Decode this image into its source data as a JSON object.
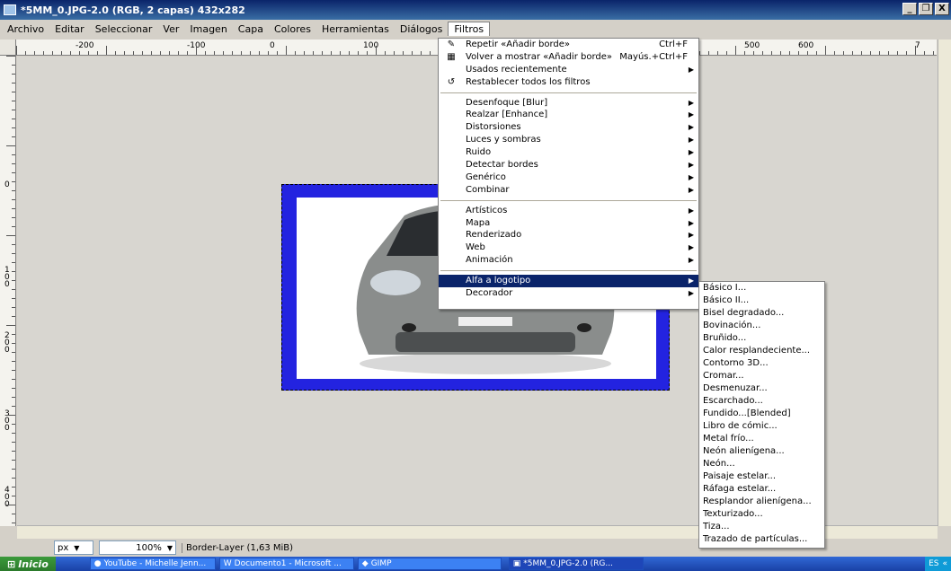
{
  "window": {
    "title": "*5MM_0.JPG-2.0 (RGB, 2 capas) 432x282",
    "buttons": [
      "_",
      "❐",
      "X"
    ]
  },
  "menubar": [
    "Archivo",
    "Editar",
    "Seleccionar",
    "Ver",
    "Imagen",
    "Capa",
    "Colores",
    "Herramientas",
    "Diálogos",
    "Filtros"
  ],
  "ruler_top": [
    "-200",
    "-100",
    "0",
    "100",
    "500",
    "600",
    "7"
  ],
  "ruler_left": [
    "0",
    "1\n0\n0",
    "2\n0\n0",
    "3\n0\n0",
    "4\n0\n0"
  ],
  "filtros_menu": {
    "items": [
      {
        "label": "Repetir «Añadir borde»",
        "accel": "Ctrl+F",
        "icon": "repeat-icon"
      },
      {
        "label": "Volver a mostrar «Añadir borde»",
        "accel": "Mayús.+Ctrl+F",
        "icon": "reshow-icon"
      },
      {
        "label": "Usados recientemente",
        "arrow": true
      },
      {
        "label": "Restablecer todos los filtros",
        "icon": "reset-icon"
      },
      {
        "sep": true
      },
      {
        "label": "Desenfoque [Blur]",
        "arrow": true
      },
      {
        "label": "Realzar [Enhance]",
        "arrow": true
      },
      {
        "label": "Distorsiones",
        "arrow": true
      },
      {
        "label": "Luces y sombras",
        "arrow": true
      },
      {
        "label": "Ruido",
        "arrow": true
      },
      {
        "label": "Detectar bordes",
        "arrow": true
      },
      {
        "label": "Genérico",
        "arrow": true
      },
      {
        "label": "Combinar",
        "arrow": true
      },
      {
        "sep": true
      },
      {
        "label": "Artísticos",
        "arrow": true
      },
      {
        "label": "Mapa",
        "arrow": true
      },
      {
        "label": "Renderizado",
        "arrow": true
      },
      {
        "label": "Web",
        "arrow": true
      },
      {
        "label": "Animación",
        "arrow": true
      },
      {
        "sep": true
      },
      {
        "label": "Alfa a logotipo",
        "arrow": true,
        "selected": true
      },
      {
        "label": "Decorador",
        "arrow": true
      }
    ]
  },
  "sub_menu": {
    "items": [
      "Básico I...",
      "Básico II...",
      "Bisel degradado...",
      "Bovinación...",
      "Bruñido...",
      "Calor resplandeciente...",
      "Contorno 3D...",
      "Cromar...",
      "Desmenuzar...",
      "Escarchado...",
      "Fundido...[Blended]",
      "Libro de cómic...",
      "Metal frío...",
      "Neón alienígena...",
      "Neón...",
      "Paisaje estelar...",
      "Ráfaga estelar...",
      "Resplandor alienígena...",
      "Texturizado...",
      "Tiza...",
      "Trazado de partículas..."
    ]
  },
  "statusbar": {
    "unit": "px",
    "zoom": "100%",
    "layer": "Border-Layer (1,63 MiB)"
  },
  "taskbar": {
    "start": "Inicio",
    "tasks": [
      "YouTube - Michelle Jenn...",
      "Documento1 - Microsoft ...",
      "GIMP",
      "*5MM_0.JPG-2.0 (RG..."
    ],
    "tray_lang": "ES",
    "tray_extra": "«"
  },
  "colors": {
    "titlebar": "#0a246a",
    "border": "#2323e0",
    "selection": "#0a246a"
  }
}
